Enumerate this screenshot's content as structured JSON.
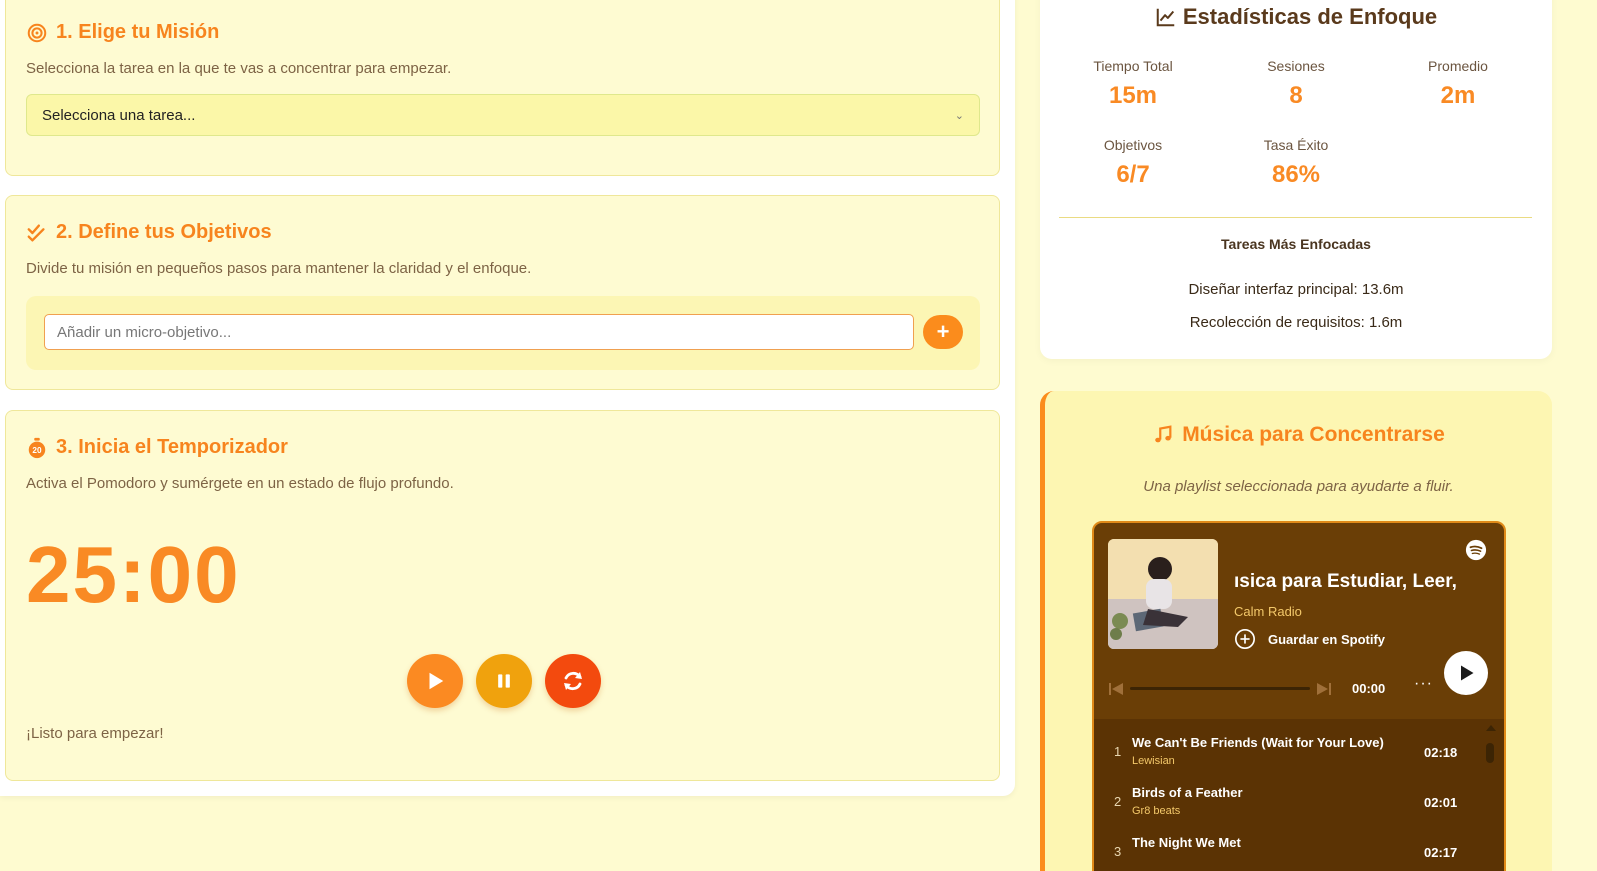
{
  "mission": {
    "title": "1. Elige tu Misión",
    "description": "Selecciona la tarea en la que te vas a concentrar para empezar.",
    "select_value": "Selecciona una tarea..."
  },
  "objectives": {
    "title": "2. Define tus Objetivos",
    "description": "Divide tu misión en pequeños pasos para mantener la claridad y el enfoque.",
    "input_placeholder": "Añadir un micro-objetivo...",
    "add_label": "+"
  },
  "timer": {
    "title": "3. Inicia el Temporizador",
    "description": "Activa el Pomodoro y sumérgete en un estado de flujo profundo.",
    "display": "25:00",
    "status": "¡Listo para empezar!"
  },
  "stats": {
    "title": "Estadísticas de Enfoque",
    "items": [
      {
        "label": "Tiempo Total",
        "value": "15m"
      },
      {
        "label": "Sesiones",
        "value": "8"
      },
      {
        "label": "Promedio",
        "value": "2m"
      },
      {
        "label": "Objetivos",
        "value": "6/7"
      },
      {
        "label": "Tasa Éxito",
        "value": "86%"
      }
    ],
    "top_title": "Tareas Más Enfocadas",
    "top_tasks": [
      "Diseñar interfaz principal: 13.6m",
      "Recolección de requisitos: 1.6m"
    ]
  },
  "music": {
    "title": "Música para Concentrarse",
    "subtitle": "Una playlist seleccionada para ayudarte a fluir.",
    "player": {
      "title": "ısica para Estudiar, Leer,",
      "artist": "Calm Radio",
      "save_label": "Guardar en Spotify",
      "time": "00:00",
      "more": "···",
      "tracks": [
        {
          "num": "1",
          "name": "We Can't Be Friends (Wait for Your Love)",
          "artist": "Lewisian",
          "duration": "02:18"
        },
        {
          "num": "2",
          "name": "Birds of a Feather",
          "artist": "Gr8 beats",
          "duration": "02:01"
        },
        {
          "num": "3",
          "name": "The Night We Met",
          "artist": "",
          "duration": "02:17"
        }
      ]
    }
  },
  "colors": {
    "accent": "#f98a24",
    "background": "#fefbd0",
    "player_bg": "#6a3e06",
    "reset": "#f34a0e",
    "pause": "#f0a20d"
  }
}
